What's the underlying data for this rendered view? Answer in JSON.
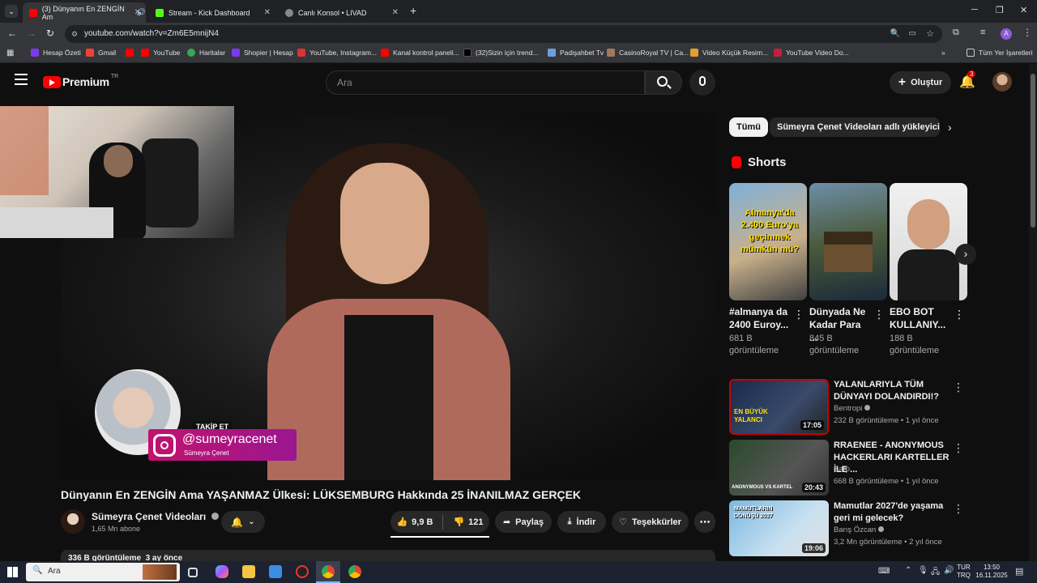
{
  "browser": {
    "tabs": [
      {
        "label": "(3) Dünyanın En ZENGİN Am",
        "active": true
      },
      {
        "label": "Stream - Kick Dashboard",
        "active": false
      },
      {
        "label": "Canlı Konsol • LIVAD",
        "active": false
      }
    ],
    "new_tab": "+",
    "url": "youtube.com/watch?v=Zm6E5mnijN4",
    "bookmarks": [
      "Hesap Özeti",
      "Gmail",
      "YouTube",
      "Haritalar",
      "Shopier | Hesap",
      "YouTube, Instagram...",
      "Kanal kontrol paneli...",
      "(32)Sizin için trend...",
      "Padişahbet Tv",
      "CasinoRoyal TV | Ca...",
      "Video Küçük Resim...",
      "YouTube Video Do..."
    ],
    "all_bookmarks": "Tüm Yer İşaretleri"
  },
  "youtube": {
    "logo": "Premium",
    "country": "TR",
    "search_placeholder": "Ara",
    "create_label": "Oluştur",
    "notif_count": "3"
  },
  "overlay": {
    "follow": "TAKİP ET",
    "handle": "@sumeyracenet",
    "name": "Sümeyra Çenet"
  },
  "video": {
    "title": "Dünyanın En ZENGİN Ama YAŞANMAZ Ülkesi: LÜKSEMBURG Hakkında 25 İNANILMAZ GERÇEK",
    "channel": "Sümeyra Çenet Videoları",
    "subscribers": "1,65 Mn abone",
    "likes": "9,9 B",
    "dislikes": "121",
    "share": "Paylaş",
    "download": "İndir",
    "thanks": "Teşekkürler",
    "desc_preview": "336 B görüntüleme  3 ay önce"
  },
  "sidebar": {
    "chips": [
      "Tümü",
      "Sümeyra Çenet Videoları adlı yükleyiciden"
    ],
    "shorts_title": "Shorts",
    "shorts": [
      {
        "title": "#almanya da 2400 Euroy...",
        "views": "681 B görüntüleme",
        "thumb_text": "Almanya'da 2.400 Euro'ya geçinmek mümkün mü?"
      },
      {
        "title": "Dünyada Ne Kadar Para ...",
        "views": "845 B görüntüleme",
        "thumb_text": ""
      },
      {
        "title": "EBO BOT KULLANIY...",
        "views": "188 B görüntüleme",
        "thumb_text": ""
      }
    ],
    "videos": [
      {
        "title": "YALANLARIYLA TÜM DÜNYAYI DOLANDIRDI!?",
        "channel": "Bentropi",
        "meta": "232 B görüntüleme • 1 yıl önce",
        "duration": "17:05",
        "thumb_text": "EN BÜYÜK YALANCI"
      },
      {
        "title": "RRAENEE - ANONYMOUS HACKERLARI KARTELLER İLE ...",
        "channel": "Sarp",
        "meta": "668 B görüntüleme • 1 yıl önce",
        "duration": "20:43",
        "thumb_text": "ANONYMOUS VS KARTEL"
      },
      {
        "title": "Mamutlar 2027'de yaşama geri mi gelecek?",
        "channel": "Barış Özcan",
        "meta": "3,2 Mn görüntüleme • 2 yıl önce",
        "duration": "19:06",
        "thumb_text": "MAMUTLARIN DÖNÜŞÜ 2027"
      }
    ]
  },
  "taskbar": {
    "search": "Ara",
    "lang1": "TUR",
    "lang2": "TRQ",
    "time": "13:50",
    "date": "16.11.2025"
  },
  "colors": {
    "youtube_red": "#ff0000",
    "bg": "#0f0f0f",
    "pill": "#272727"
  }
}
